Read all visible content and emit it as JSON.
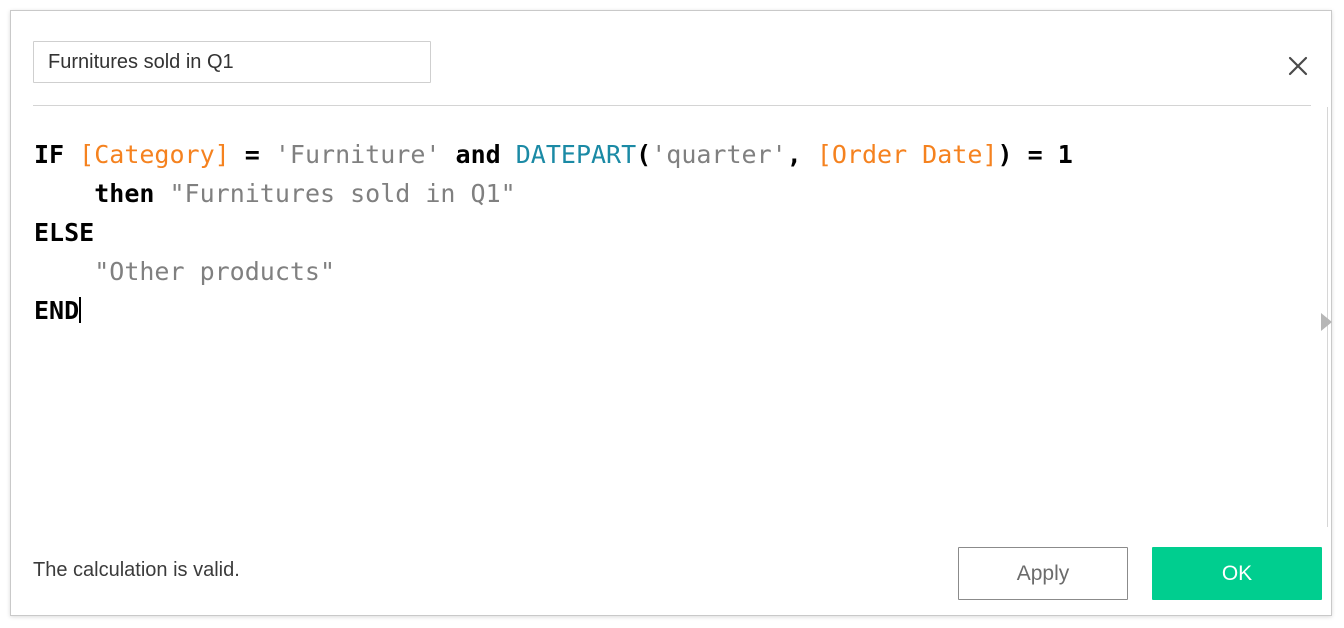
{
  "dialog": {
    "name": "calculated-field-editor",
    "accent_color": "#00ce8f",
    "border_color": "#c9c9c9"
  },
  "header": {
    "title_value": "Furnitures sold in Q1",
    "title_placeholder": "Enter field name",
    "close_icon": "close-icon"
  },
  "formula": {
    "lines": [
      {
        "tokens": [
          {
            "text": "IF",
            "type": "keyword"
          },
          {
            "text": " ",
            "type": "plain"
          },
          {
            "text": "[Category]",
            "type": "field"
          },
          {
            "text": " ",
            "type": "plain"
          },
          {
            "text": "=",
            "type": "operator"
          },
          {
            "text": " ",
            "type": "plain"
          },
          {
            "text": "'Furniture'",
            "type": "string"
          },
          {
            "text": " ",
            "type": "plain"
          },
          {
            "text": "and",
            "type": "keyword"
          },
          {
            "text": " ",
            "type": "plain"
          },
          {
            "text": "DATEPART",
            "type": "function"
          },
          {
            "text": "(",
            "type": "operator"
          },
          {
            "text": "'quarter'",
            "type": "string"
          },
          {
            "text": ",",
            "type": "operator"
          },
          {
            "text": " ",
            "type": "plain"
          },
          {
            "text": "[Order Date]",
            "type": "field"
          },
          {
            "text": ")",
            "type": "operator"
          },
          {
            "text": " ",
            "type": "plain"
          },
          {
            "text": "=",
            "type": "operator"
          },
          {
            "text": " ",
            "type": "plain"
          },
          {
            "text": "1",
            "type": "number"
          }
        ]
      },
      {
        "tokens": [
          {
            "text": "    ",
            "type": "plain"
          },
          {
            "text": "then",
            "type": "keyword"
          },
          {
            "text": " ",
            "type": "plain"
          },
          {
            "text": "\"Furnitures sold in Q1\"",
            "type": "string"
          }
        ]
      },
      {
        "tokens": [
          {
            "text": "ELSE",
            "type": "keyword"
          }
        ]
      },
      {
        "tokens": [
          {
            "text": "    ",
            "type": "plain"
          },
          {
            "text": "\"Other products\"",
            "type": "string"
          }
        ]
      },
      {
        "tokens": [
          {
            "text": "END",
            "type": "keyword"
          }
        ],
        "caret": true
      }
    ],
    "colors": {
      "keyword": "#000000",
      "field": "#f5821f",
      "function": "#1b8aa5",
      "string": "#808080",
      "operator": "#000000",
      "number": "#000000"
    }
  },
  "splitter": {
    "handle_icon": "triangle-right-icon"
  },
  "footer": {
    "status_text": "The calculation is valid.",
    "apply_label": "Apply",
    "ok_label": "OK"
  }
}
